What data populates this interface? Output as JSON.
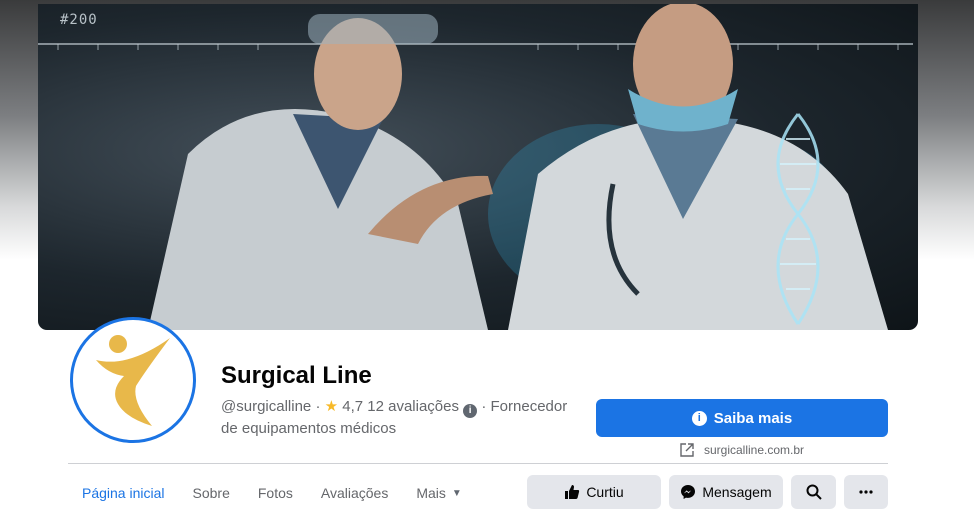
{
  "cover": {
    "tag": "#200"
  },
  "page": {
    "name": "Surgical Line",
    "handle": "@surgicalline",
    "separator": "·",
    "rating": "4,7",
    "reviews": "12 avaliações",
    "category": "Fornecedor de equipamentos médicos"
  },
  "cta": {
    "label": "Saiba mais",
    "icon": "info-icon"
  },
  "website": {
    "url": "surgicalline.com.br",
    "icon": "external-link-icon"
  },
  "tabs": [
    {
      "label": "Página inicial",
      "active": true
    },
    {
      "label": "Sobre"
    },
    {
      "label": "Fotos"
    },
    {
      "label": "Avaliações"
    },
    {
      "label": "Mais"
    }
  ],
  "actions": {
    "like": "Curtiu",
    "message": "Mensagem",
    "search_icon": "search-icon",
    "more_icon": "more-dots-icon"
  },
  "colors": {
    "accent": "#1b74e4",
    "secondary_button": "#e4e6eb",
    "logo_gold": "#e8b84a"
  }
}
